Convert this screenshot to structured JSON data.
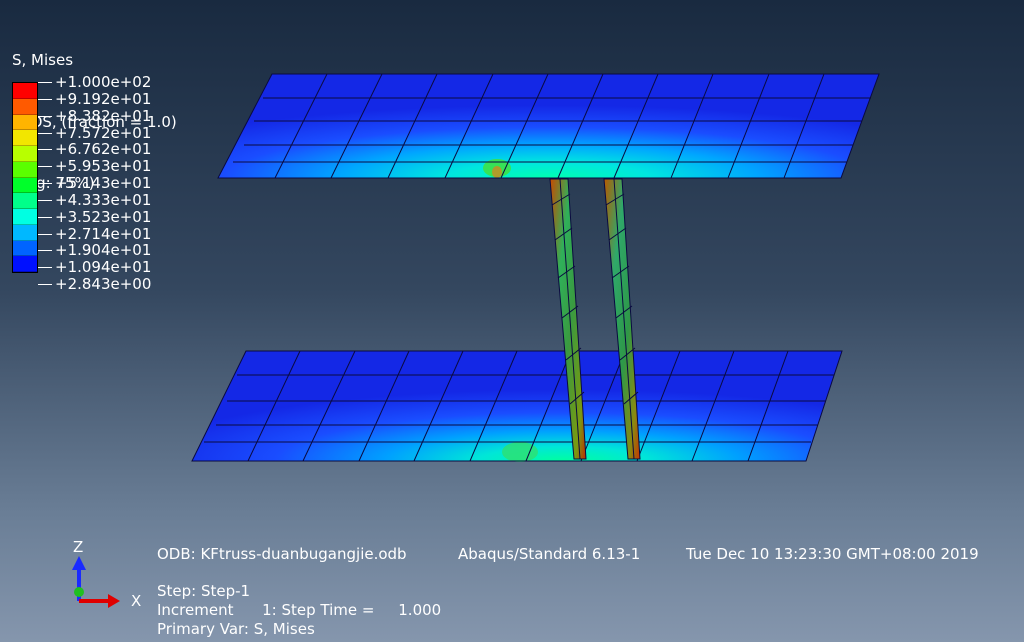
{
  "legend": {
    "title_lines": [
      "S, Mises",
      "SPOS, (fraction = 1.0)",
      "(Avg: 75%)"
    ],
    "values": [
      "+1.000e+02",
      "+9.192e+01",
      "+8.382e+01",
      "+7.572e+01",
      "+6.762e+01",
      "+5.953e+01",
      "+5.143e+01",
      "+4.333e+01",
      "+3.523e+01",
      "+2.714e+01",
      "+1.904e+01",
      "+1.094e+01",
      "+2.843e+00"
    ],
    "colors": [
      "#ff0000",
      "#ff5a00",
      "#ffb400",
      "#f2e600",
      "#b8ff00",
      "#5aff00",
      "#00ff2a",
      "#00ff8a",
      "#00ffe2",
      "#00b8ff",
      "#0064ff",
      "#0010ff"
    ]
  },
  "triad": {
    "z_label": "Z",
    "x_label": "X"
  },
  "info": {
    "odb": "ODB: KFtruss-duanbugangjie.odb",
    "solver": "Abaqus/Standard 6.13-1",
    "date": "Tue Dec 10 13:23:30 GMT+08:00 2019",
    "step": "Step: Step-1",
    "increment": "Increment      1: Step Time =     1.000",
    "primary_var": "Primary Var: S, Mises"
  }
}
